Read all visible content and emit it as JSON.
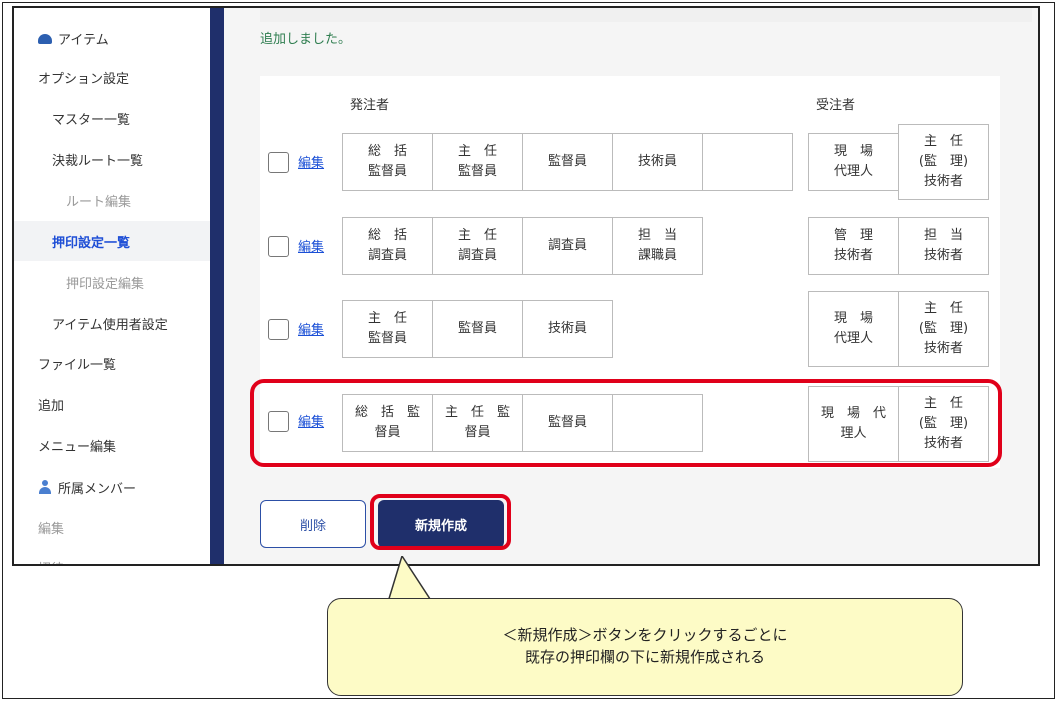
{
  "sidebar": {
    "items": [
      {
        "label": "アイテム"
      },
      {
        "label": "オプション設定"
      },
      {
        "label": "マスター一覧"
      },
      {
        "label": "決裁ルート一覧"
      },
      {
        "label": "ルート編集"
      },
      {
        "label": "押印設定一覧"
      },
      {
        "label": "押印設定編集"
      },
      {
        "label": "アイテム使用者設定"
      },
      {
        "label": "ファイル一覧"
      },
      {
        "label": "追加"
      },
      {
        "label": "メニュー編集"
      },
      {
        "label": "所属メンバー"
      },
      {
        "label": "編集"
      },
      {
        "label": "招待"
      }
    ]
  },
  "main": {
    "flash": "追加しました。",
    "col_orderer": "発注者",
    "col_contractor": "受注者",
    "edit_label": "編集",
    "rows": [
      {
        "orderer": [
          "総　括\n監督員",
          "主　任\n監督員",
          "監督員",
          "技術員",
          ""
        ],
        "contractor": [
          "現　場\n代理人",
          "主　任\n(監　理)\n技術者"
        ]
      },
      {
        "orderer": [
          "総　括\n調査員",
          "主　任\n調査員",
          "調査員",
          "担　当\n課職員"
        ],
        "contractor": [
          "管　理\n技術者",
          "担　当\n技術者"
        ]
      },
      {
        "orderer": [
          "主　任\n監督員",
          "監督員",
          "技術員"
        ],
        "contractor": [
          "現　場\n代理人",
          "主　任\n(監　理)\n技術者"
        ]
      },
      {
        "orderer": [
          "総　括　監\n督員",
          "主　任　監\n督員",
          "監督員",
          ""
        ],
        "contractor": [
          "現　場　代\n理人",
          "主　任\n(監　理)\n技術者"
        ]
      }
    ],
    "delete_label": "削除",
    "new_label": "新規作成"
  },
  "callout": {
    "line1": "＜新規作成＞ボタンをクリックするごとに",
    "line2": "既存の押印欄の下に新規作成される"
  },
  "colors": {
    "navy": "#1f2f6b",
    "highlight": "#e0001a",
    "link": "#1a4fd6",
    "success": "#2e7d4f",
    "callout_bg": "#fdfbc6"
  }
}
